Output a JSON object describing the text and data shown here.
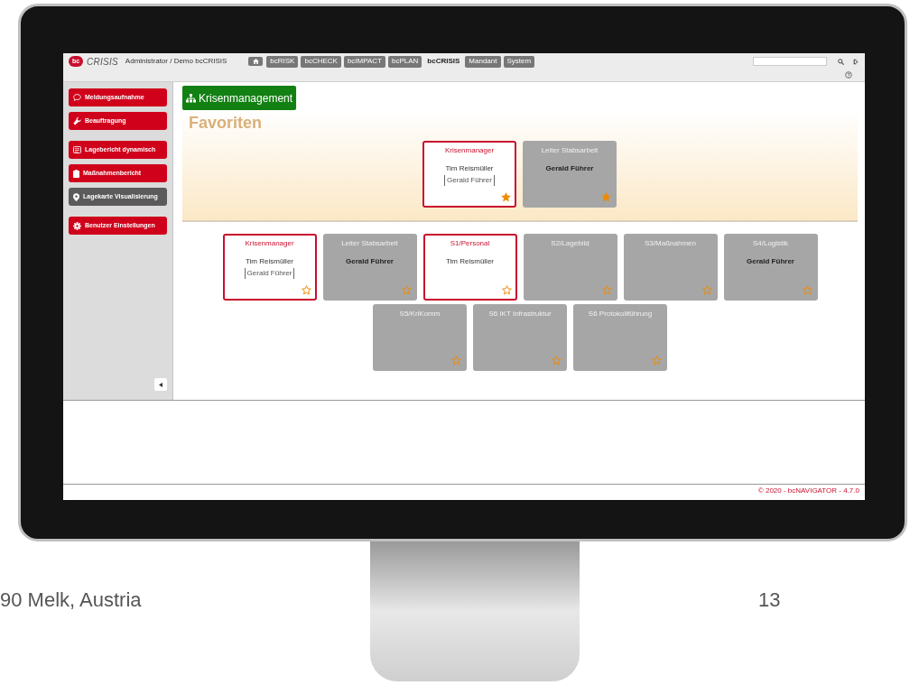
{
  "header": {
    "logo": "bc",
    "product": "CRISIS",
    "user_path": "Administrator / Demo bcCRISIS",
    "nav": [
      {
        "label": "bcRISK",
        "selected": false
      },
      {
        "label": "bcCHECK",
        "selected": false
      },
      {
        "label": "bcIMPACT",
        "selected": false
      },
      {
        "label": "bcPLAN",
        "selected": false
      },
      {
        "label": "bcCRISIS",
        "selected": true
      },
      {
        "label": "Mandant",
        "selected": false
      },
      {
        "label": "System",
        "selected": false
      }
    ]
  },
  "sidebar": {
    "groups": [
      [
        {
          "label": "Meldungsaufnahme",
          "disabled": false
        },
        {
          "label": "Beauftragung",
          "disabled": false
        }
      ],
      [
        {
          "label": "Lagebericht dynamisch",
          "disabled": false
        },
        {
          "label": "Maßnahmenbericht",
          "disabled": false
        },
        {
          "label": "Lagekarte Visualisierung",
          "disabled": true
        }
      ],
      [
        {
          "label": "Benutzer Einstellungen",
          "disabled": false
        }
      ]
    ]
  },
  "section_button": "Krisenmanagement",
  "favorites": {
    "title": "Favoriten",
    "cards": [
      {
        "title": "Krisenmanager",
        "person": "Tim Reismüller",
        "deputy": "Gerald Führer",
        "highlighted": true,
        "favorite": true
      },
      {
        "title": "Leiter Stabsarbeit",
        "person": "Gerald Führer",
        "highlighted": false,
        "favorite": true
      }
    ]
  },
  "roles": [
    [
      {
        "title": "Krisenmanager",
        "person": "Tim Reismüller",
        "deputy": "Gerald Führer",
        "highlighted": true,
        "favorite": false
      },
      {
        "title": "Leiter Stabsarbeit",
        "person": "Gerald Führer",
        "highlighted": false,
        "favorite": false
      },
      {
        "title": "S1/Personal",
        "person": "Tim Reismüller",
        "highlighted": true,
        "favorite": false
      },
      {
        "title": "S2/Lagebild",
        "highlighted": false,
        "favorite": false
      },
      {
        "title": "S3/Maßnahmen",
        "highlighted": false,
        "favorite": false
      },
      {
        "title": "S4/Logistik",
        "person": "Gerald Führer",
        "highlighted": false,
        "favorite": false
      }
    ],
    [
      {
        "title": "S5/KriKomm",
        "highlighted": false,
        "favorite": false
      },
      {
        "title": "S6 IKT Infrastruktur",
        "highlighted": false,
        "favorite": false
      },
      {
        "title": "S6 Protokollführung",
        "highlighted": false,
        "favorite": false
      }
    ]
  ],
  "footer": "© 2020 - bcNAVIGATOR - 4.7.0",
  "slide_caption": "90 Melk, Austria",
  "page_number": "13"
}
